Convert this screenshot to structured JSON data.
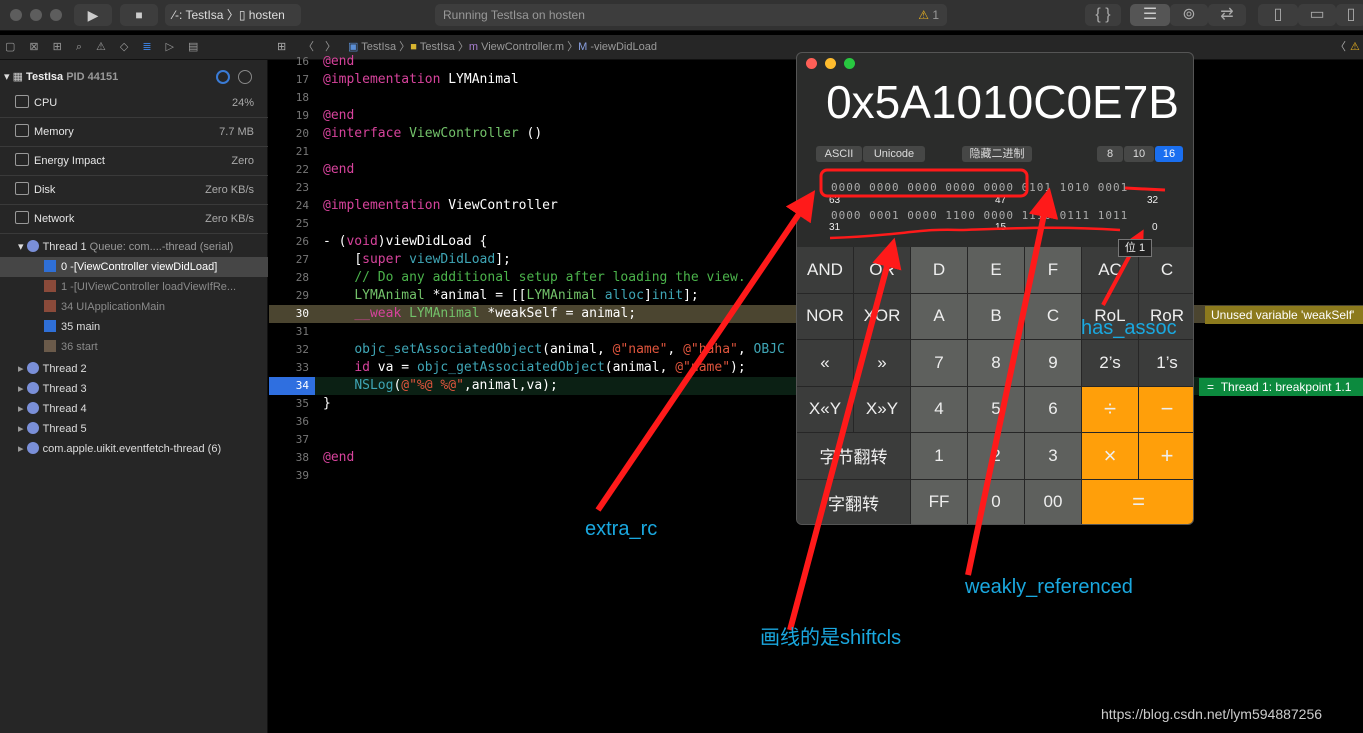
{
  "toolbar": {
    "scheme": "TestIsa",
    "device": "hosten",
    "status": "Running TestIsa on hosten",
    "warning_count": "1"
  },
  "navbar": {
    "breadcrumb": [
      "TestIsa",
      "TestIsa",
      "ViewController.m",
      "-viewDidLoad"
    ]
  },
  "sidebar": {
    "process": "TestIsa",
    "pid": "PID 44151",
    "gauges": [
      {
        "label": "CPU",
        "value": "24%",
        "icon": "cpu-icon"
      },
      {
        "label": "Memory",
        "value": "7.7 MB",
        "icon": "memory-icon"
      },
      {
        "label": "Energy Impact",
        "value": "Zero",
        "icon": "battery-icon"
      },
      {
        "label": "Disk",
        "value": "Zero KB/s",
        "icon": "disk-icon"
      },
      {
        "label": "Network",
        "value": "Zero KB/s",
        "icon": "network-icon"
      }
    ],
    "thread1": {
      "name": "Thread 1",
      "queue": "Queue: com....-thread (serial)"
    },
    "frames": [
      "0 -[ViewController viewDidLoad]",
      "1 -[UIViewController loadViewIfRe...",
      "34 UIApplicationMain",
      "35 main",
      "36 start"
    ],
    "threads": [
      "Thread 2",
      "Thread 3",
      "Thread 4",
      "Thread 5",
      "com.apple.uikit.eventfetch-thread (6)"
    ]
  },
  "editor": {
    "lines": [
      {
        "n": "16",
        "html": "<span class='kw'>@end</span>"
      },
      {
        "n": "17",
        "html": "<span class='kw'>@implementation</span> <span class='pl'>LYMAnimal</span>"
      },
      {
        "n": "18",
        "html": ""
      },
      {
        "n": "19",
        "html": "<span class='kw'>@end</span>"
      },
      {
        "n": "20",
        "html": "<span class='kw'>@interface</span> <span class='ty'>ViewController</span> <span class='pl'>()</span>"
      },
      {
        "n": "21",
        "html": ""
      },
      {
        "n": "22",
        "html": "<span class='kw'>@end</span>"
      },
      {
        "n": "23",
        "html": ""
      },
      {
        "n": "24",
        "html": "<span class='kw'>@implementation</span> <span class='pl'>ViewController</span>"
      },
      {
        "n": "25",
        "html": ""
      },
      {
        "n": "26",
        "html": "<span class='pl'>- (</span><span class='kw'>void</span><span class='pl'>)viewDidLoad {</span>"
      },
      {
        "n": "27",
        "html": "    <span class='pl'>[</span><span class='kw'>super</span> <span class='fn'>viewDidLoad</span><span class='pl'>];</span>"
      },
      {
        "n": "28",
        "html": "    <span class='cm'>// Do any additional setup after loading the view.</span>"
      },
      {
        "n": "29",
        "html": "    <span class='ty'>LYMAnimal</span> <span class='pl'>*animal = [[</span><span class='ty'>LYMAnimal</span> <span class='fn'>alloc</span><span class='pl'>]</span><span class='fn'>init</span><span class='pl'>];</span>"
      },
      {
        "n": "30",
        "html": "    <span class='kw'>__weak</span> <span class='ty'>LYMAnimal</span> <span class='pl'>*weakSelf = animal;</span>"
      },
      {
        "n": "31",
        "html": ""
      },
      {
        "n": "32",
        "html": "    <span class='fn'>objc_setAssociatedObject</span><span class='pl'>(animal, </span><span class='st'>@\"name\"</span><span class='pl'>, </span><span class='st'>@\"haha\"</span><span class='pl'>, </span><span class='fn'>OBJC</span>"
      },
      {
        "n": "33",
        "html": "    <span class='kw'>id</span> <span class='pl'>va = </span><span class='fn'>objc_getAssociatedObject</span><span class='pl'>(animal, </span><span class='st'>@\"name\"</span><span class='pl'>);</span>"
      },
      {
        "n": "34",
        "html": "    <span class='fn'>NSLog</span><span class='pl'>(</span><span class='st'>@\"%@ %@\"</span><span class='pl'>,animal,va);</span>"
      },
      {
        "n": "35",
        "html": "<span class='pl'>}</span>"
      },
      {
        "n": "36",
        "html": ""
      },
      {
        "n": "37",
        "html": ""
      },
      {
        "n": "38",
        "html": "<span class='kw'>@end</span>"
      },
      {
        "n": "39",
        "html": ""
      }
    ],
    "warning": "Unused variable 'weakSelf'",
    "breakpoint": "Thread 1: breakpoint 1.1"
  },
  "calculator": {
    "display": "0x5A1010C0E7B",
    "mode_buttons": [
      "ASCII",
      "Unicode"
    ],
    "hide_binary": "隐藏二进制",
    "bases": [
      "8",
      "10",
      "16"
    ],
    "selected_base": "16",
    "bits_high": "0000 0000 0000 0000 0000 0101 1010 0001",
    "bits_low": "0000 0001 0000 1100 0000 1110 0111 1011",
    "bit_labels": [
      "63",
      "47",
      "32",
      "31",
      "15",
      "0"
    ],
    "tooltip": "位 1",
    "keys": [
      [
        "AND",
        "OR",
        "D",
        "E",
        "F",
        "AC",
        "C"
      ],
      [
        "NOR",
        "XOR",
        "A",
        "B",
        "C",
        "RoL",
        "RoR"
      ],
      [
        "«",
        "»",
        "7",
        "8",
        "9",
        "2’s",
        "1’s"
      ],
      [
        "X«Y",
        "X»Y",
        "4",
        "5",
        "6",
        "÷",
        "−"
      ],
      [
        "字节翻转",
        "1",
        "2",
        "3",
        "×",
        "+"
      ],
      [
        "字翻转",
        "FF",
        "0",
        "00",
        "="
      ]
    ],
    "accent": "#ff9f0a"
  },
  "annotations": {
    "extra_rc": "extra_rc",
    "shiftcls": "画线的是shiftcls",
    "weakly_referenced": "weakly_referenced",
    "has_assoc": "has_assoc",
    "color": "#1aa8df",
    "arrow_color": "#ff1a1a"
  },
  "watermark": "https://blog.csdn.net/lym594887256"
}
